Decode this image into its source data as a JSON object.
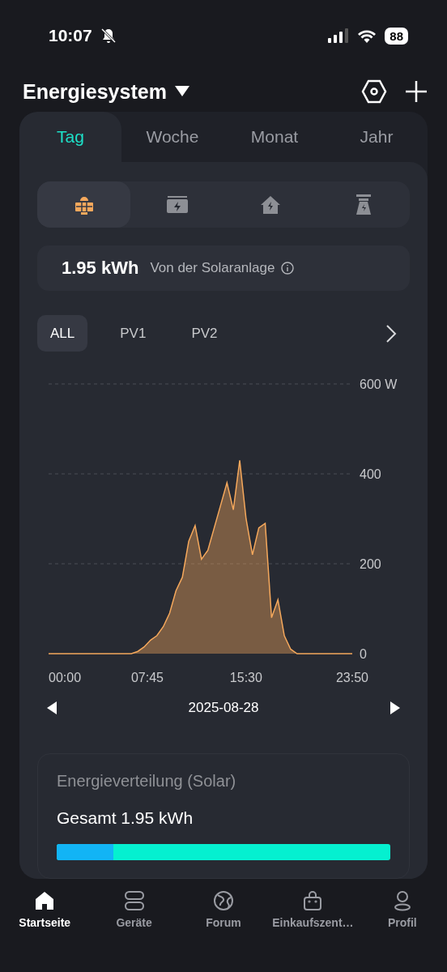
{
  "status_bar": {
    "time": "10:07",
    "battery": "88"
  },
  "header": {
    "title": "Energiesystem"
  },
  "period_tabs": [
    {
      "label": "Tag",
      "selected": true
    },
    {
      "label": "Woche",
      "selected": false
    },
    {
      "label": "Monat",
      "selected": false
    },
    {
      "label": "Jahr",
      "selected": false
    }
  ],
  "sources": [
    {
      "kind": "solar",
      "selected": true
    },
    {
      "kind": "battery",
      "selected": false
    },
    {
      "kind": "home",
      "selected": false
    },
    {
      "kind": "grid",
      "selected": false
    }
  ],
  "summary": {
    "value": "1.95 kWh",
    "label": "Von der Solaranlage"
  },
  "channels": [
    {
      "label": "ALL",
      "selected": true
    },
    {
      "label": "PV1",
      "selected": false
    },
    {
      "label": "PV2",
      "selected": false
    }
  ],
  "chart": {
    "chart_data": {
      "type": "area",
      "x": [
        0,
        30,
        60,
        90,
        120,
        150,
        180,
        210,
        240,
        270,
        300,
        330,
        360,
        390,
        420,
        450,
        480,
        510,
        540,
        570,
        600,
        630,
        660,
        690,
        720,
        750,
        780,
        810,
        840,
        870,
        900,
        930,
        960,
        990,
        1020,
        1050,
        1080,
        1110,
        1140,
        1170,
        1200,
        1230,
        1260,
        1290,
        1320,
        1350,
        1380,
        1410,
        1430
      ],
      "series": [
        {
          "color": "#f5a85c",
          "values": [
            0,
            0,
            0,
            0,
            0,
            0,
            0,
            0,
            0,
            0,
            0,
            0,
            0,
            0,
            5,
            15,
            30,
            40,
            60,
            90,
            140,
            170,
            250,
            285,
            210,
            230,
            280,
            330,
            380,
            320,
            430,
            300,
            220,
            280,
            290,
            80,
            120,
            40,
            10,
            0,
            0,
            0,
            0,
            0,
            0,
            0,
            0,
            0,
            0
          ]
        }
      ],
      "xlim": [
        0,
        1430
      ],
      "ylim": [
        0,
        600
      ],
      "xticks": [
        {
          "value": 0,
          "label": "00:00"
        },
        {
          "value": 465,
          "label": "07:45"
        },
        {
          "value": 930,
          "label": "15:30"
        },
        {
          "value": 1430,
          "label": "23:50"
        }
      ],
      "yticks": [
        {
          "value": 0,
          "label": "0"
        },
        {
          "value": 200,
          "label": "200"
        },
        {
          "value": 400,
          "label": "400"
        },
        {
          "value": 600,
          "label": "600 W"
        }
      ]
    }
  },
  "date": "2025-08-28",
  "distribution": {
    "title": "Energieverteilung (Solar)",
    "total": "Gesamt 1.95 kWh",
    "segments": [
      {
        "level": 0.17,
        "color": "#12b4f5"
      },
      {
        "color": "#05f0d0"
      }
    ]
  },
  "nav": [
    {
      "label": "Startseite",
      "selected": true,
      "kind": "home"
    },
    {
      "label": "Geräte",
      "selected": false,
      "kind": "devices"
    },
    {
      "label": "Forum",
      "selected": false,
      "kind": "globe"
    },
    {
      "label": "Einkaufszent…",
      "selected": false,
      "kind": "shop"
    },
    {
      "label": "Profil",
      "selected": false,
      "kind": "profile"
    }
  ]
}
